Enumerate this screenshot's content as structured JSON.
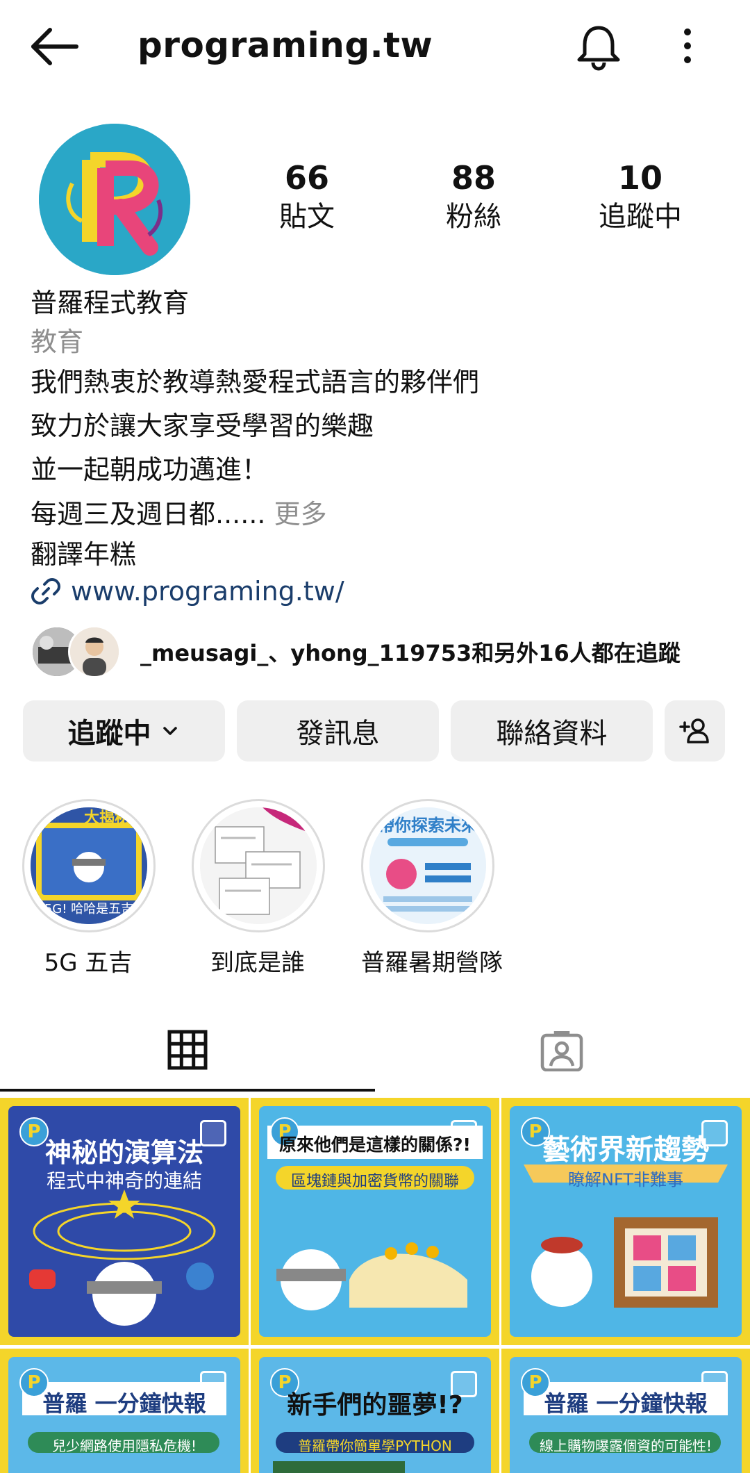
{
  "header": {
    "username": "programing.tw"
  },
  "stats": [
    {
      "value": "66",
      "label": "貼文"
    },
    {
      "value": "88",
      "label": "粉絲"
    },
    {
      "value": "10",
      "label": "追蹤中"
    }
  ],
  "profile": {
    "name": "普羅程式教育",
    "category": "教育",
    "bio_lines": [
      "我們熱衷於教導熱愛程式語言的夥伴們",
      "致力於讓大家享受學習的樂趣",
      "並一起朝成功邁進！"
    ],
    "bio_truncated": "每週三及週日都......",
    "more_label": "更多",
    "translate_label": "翻譯年糕",
    "website": "www.programing.tw/"
  },
  "followed_by": "_meusagi_、yhong_119753和另外16人都在追蹤",
  "actions": {
    "following_label": "追蹤中",
    "message_label": "發訊息",
    "contact_label": "聯絡資料"
  },
  "highlights": [
    {
      "label": "5G 五吉"
    },
    {
      "label": "到底是誰"
    },
    {
      "label": "普羅暑期營隊"
    }
  ],
  "posts": [
    {
      "title": "神秘的演算法",
      "subtitle": "程式中神奇的連結",
      "bg": "#2f4aa8"
    },
    {
      "title": "原來他們是這樣的關係?!",
      "subtitle": "區塊鏈與加密貨幣的關聯",
      "bg": "#4fb6e6"
    },
    {
      "title": "藝術界新趨勢",
      "subtitle": "瞭解NFT非難事",
      "bg": "#4fb6e6"
    },
    {
      "title": "普羅 一分鐘快報",
      "subtitle": "兒少網路使用隱私危機!",
      "bg": "#5cb8e8"
    },
    {
      "title": "新手們的噩夢!?",
      "subtitle": "普羅帶你簡單學PYTHON",
      "bg": "#5cb8e8"
    },
    {
      "title": "普羅 一分鐘快報",
      "subtitle": "線上購物曝露個資的可能性!",
      "bg": "#5cb8e8"
    }
  ],
  "colors": {
    "link": "#1a3d6b",
    "button_bg": "#efefef",
    "muted": "#8e8e8e",
    "tile_border": "#f4d52a"
  }
}
